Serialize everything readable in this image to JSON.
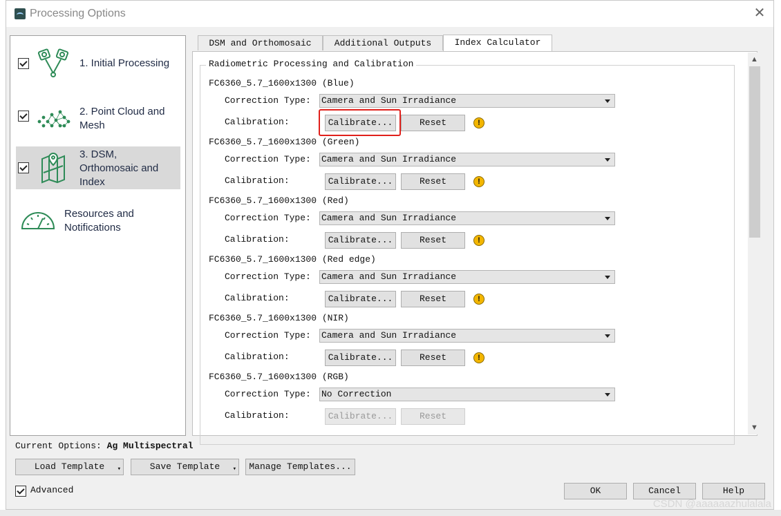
{
  "window": {
    "title": "Processing Options",
    "close_glyph": "✕"
  },
  "sidebar": {
    "items": [
      {
        "label": "1. Initial Processing",
        "icon": "cameras-icon",
        "checked": true
      },
      {
        "label": "2. Point Cloud and\nMesh",
        "icon": "point-cloud-icon",
        "checked": true
      },
      {
        "label": "3. DSM,\nOrthomosaic and\nIndex",
        "icon": "map-icon",
        "checked": true,
        "selected": true
      },
      {
        "label": "Resources and\nNotifications",
        "icon": "gauge-icon",
        "checked": false
      }
    ]
  },
  "tabs": [
    {
      "label": "DSM and Orthomosaic"
    },
    {
      "label": "Additional Outputs"
    },
    {
      "label": "Index Calculator",
      "active": true
    }
  ],
  "group": {
    "title": "Radiometric Processing and Calibration",
    "correction_label": "Correction Type:",
    "calibration_label": "Calibration:",
    "calibrate_label": "Calibrate...",
    "reset_label": "Reset",
    "warn_glyph": "!",
    "bands": [
      {
        "name": "FC6360_5.7_1600x1300 (Blue)",
        "correction": "Camera and Sun Irradiance",
        "enabled": true,
        "warning": true
      },
      {
        "name": "FC6360_5.7_1600x1300 (Green)",
        "correction": "Camera and Sun Irradiance",
        "enabled": true,
        "warning": true
      },
      {
        "name": "FC6360_5.7_1600x1300 (Red)",
        "correction": "Camera and Sun Irradiance",
        "enabled": true,
        "warning": true
      },
      {
        "name": "FC6360_5.7_1600x1300 (Red edge)",
        "correction": "Camera and Sun Irradiance",
        "enabled": true,
        "warning": true
      },
      {
        "name": "FC6360_5.7_1600x1300 (NIR)",
        "correction": "Camera and Sun Irradiance",
        "enabled": true,
        "warning": true
      },
      {
        "name": "FC6360_5.7_1600x1300 (RGB)",
        "correction": "No Correction",
        "enabled": false,
        "warning": false
      }
    ]
  },
  "footer": {
    "current_label": "Current Options:",
    "current_value": "Ag Multispectral",
    "load_template": "Load Template",
    "save_template": "Save Template",
    "manage_templates": "Manage Templates...",
    "advanced_label": "Advanced",
    "ok": "OK",
    "cancel": "Cancel",
    "help": "Help"
  },
  "watermark": "CSDN @aaaaaazhulalala",
  "colors": {
    "highlight": "#e0201b",
    "warning": "#f3b600",
    "icon_green": "#2e8b57"
  }
}
